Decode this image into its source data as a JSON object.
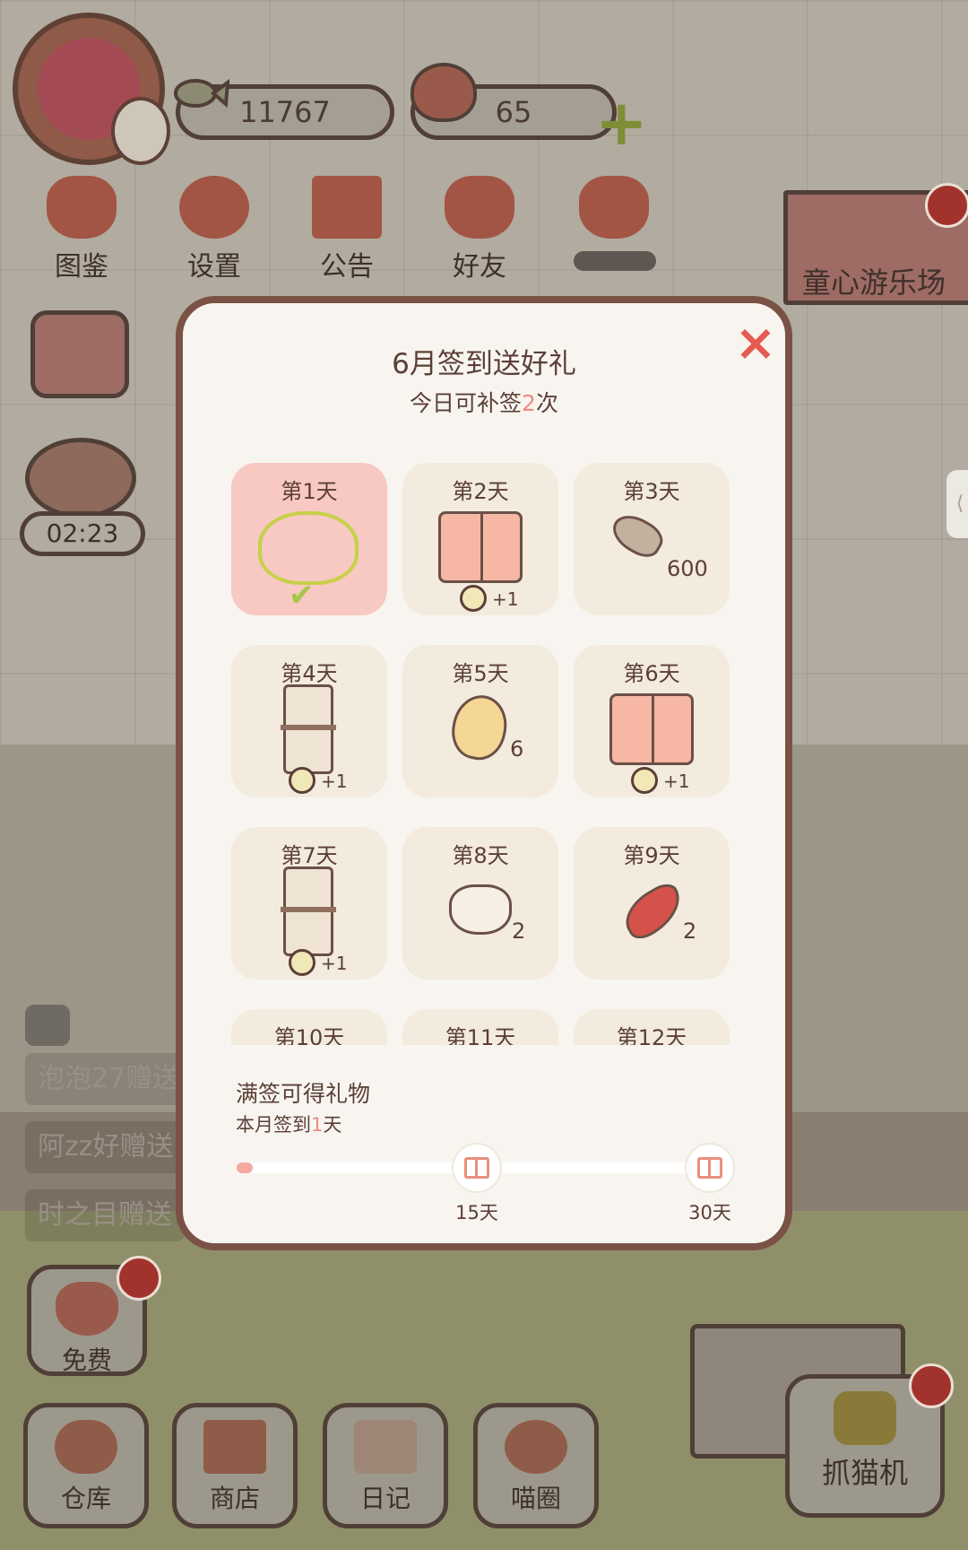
{
  "hud": {
    "fish_count": "11767",
    "heart_count": "65",
    "plus_label": "+"
  },
  "top_menu": [
    {
      "label": "图鉴"
    },
    {
      "label": "设置"
    },
    {
      "label": "公告"
    },
    {
      "label": "好友"
    }
  ],
  "park_banner": {
    "label": "童心游乐场"
  },
  "timer": {
    "value": "02:23"
  },
  "chat": [
    {
      "text": "泡泡27赠送"
    },
    {
      "text": "阿zz好赠送"
    },
    {
      "text": "时之目赠送"
    }
  ],
  "free_button": {
    "label": "免费"
  },
  "bottom_nav": [
    {
      "label": "仓库"
    },
    {
      "label": "商店"
    },
    {
      "label": "日记"
    },
    {
      "label": "喵圈"
    }
  ],
  "claw_machine": {
    "label": "抓猫机"
  },
  "modal": {
    "title": "6月签到送好礼",
    "sub_prefix": "今日可补签",
    "sub_count": "2",
    "sub_suffix": "次",
    "close_label": "×",
    "days": [
      {
        "label": "第1天",
        "reward": "cat-face-icon",
        "claimed": true,
        "check": "✔"
      },
      {
        "label": "第2天",
        "reward": "curtain-icon",
        "bonus": "+1"
      },
      {
        "label": "第3天",
        "reward": "fish-icon",
        "qty": "600"
      },
      {
        "label": "第4天",
        "reward": "shelf-icon",
        "bonus": "+1"
      },
      {
        "label": "第5天",
        "reward": "egg-icon",
        "qty": "6"
      },
      {
        "label": "第6天",
        "reward": "curtain-icon",
        "bonus": "+1"
      },
      {
        "label": "第7天",
        "reward": "shelf-icon",
        "bonus": "+1"
      },
      {
        "label": "第8天",
        "reward": "sugar-icon",
        "qty": "2"
      },
      {
        "label": "第9天",
        "reward": "chili-icon",
        "qty": "2"
      },
      {
        "label": "第10天"
      },
      {
        "label": "第11天"
      },
      {
        "label": "第12天"
      }
    ],
    "footer": {
      "title": "满签可得礼物",
      "progress_prefix": "本月签到",
      "progress_days": "1",
      "progress_suffix": "天",
      "progress_fraction": 0.033,
      "milestones": [
        {
          "label": "15天"
        },
        {
          "label": "30天"
        }
      ]
    }
  },
  "colors": {
    "accent_pink": "#f8c8c2",
    "highlight_text": "#ef8a84",
    "close_red": "#e55b52",
    "card_bg": "#f2ebde"
  }
}
